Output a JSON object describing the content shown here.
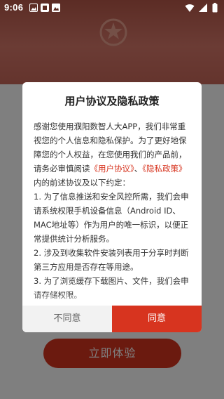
{
  "status_bar": {
    "time": "9:06"
  },
  "background": {
    "start_button_label": "立即体验"
  },
  "dialog": {
    "title": "用户协议及隐私政策",
    "intro_before_links": "感谢您使用濮阳数智人大APP，我们非常重视您的个人信息和隐私保护。为了更好地保障您的个人权益，在您使用我们的产品前，请务必审慎阅读",
    "link_user_agreement": "《用户协议》",
    "link_separator": "、",
    "link_privacy_policy": "《隐私政策》",
    "intro_after_links": "内的前述协议及以下约定：",
    "item_1": "1. 为了信息推送和安全风控所需，我们会申请系统权限手机设备信息（Android ID、MAC地址等）作为用户的唯一标识，以便正常提供统计分析服务。",
    "item_2": "2. 涉及到收集软件安装列表用于分享时判断第三方应用是否存在等用途。",
    "item_3": "3. 为了浏览缓存下载图片、文件，我们会申请存储权限。",
    "disagree_label": "不同意",
    "agree_label": "同意"
  },
  "colors": {
    "accent": "#d7341f",
    "overlay": "rgba(0,0,0,0.5)"
  },
  "icons": {
    "status_left": [
      "photo-icon",
      "notification-icon",
      "image-icon"
    ],
    "status_right": [
      "wifi-icon",
      "signal-icon",
      "battery-icon"
    ]
  }
}
